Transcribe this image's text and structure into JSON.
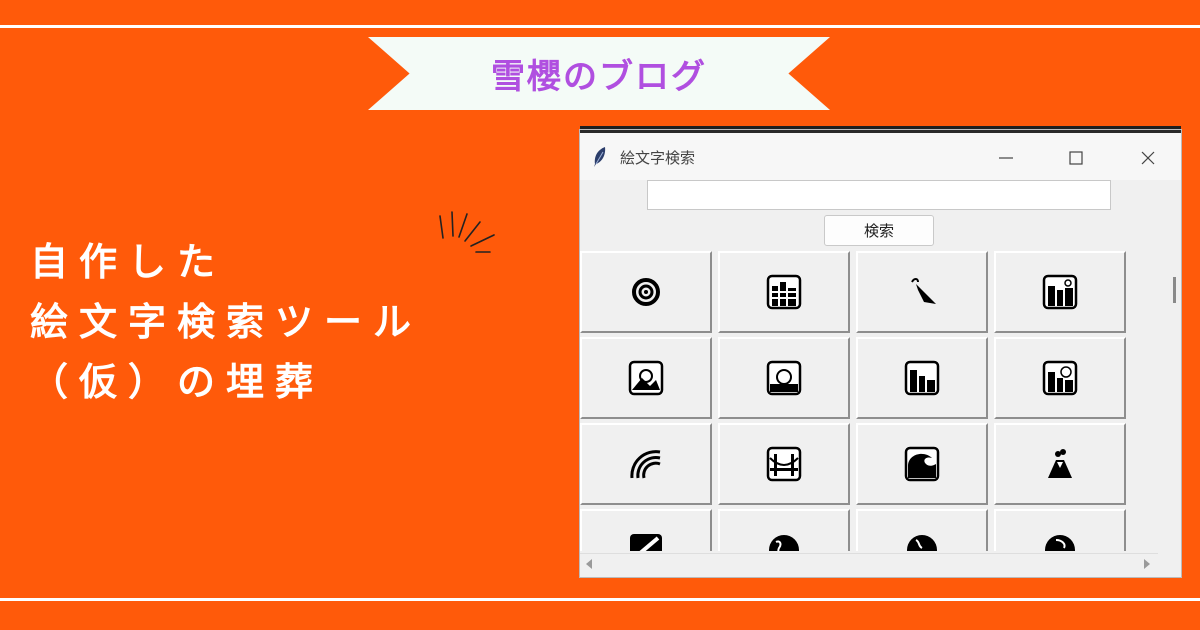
{
  "blog": {
    "name": "雪櫻のブログ"
  },
  "headline": {
    "line1": "自作した",
    "line2": "絵文字検索ツール",
    "line3": "（仮）の埋葬"
  },
  "window": {
    "title": "絵文字検索",
    "search_placeholder": "",
    "search_value": "",
    "search_button": "検索"
  },
  "emoji_grid": {
    "rows": [
      [
        "cyclone-icon",
        "foggy-city-icon",
        "closed-umbrella-icon",
        "night-city-icon"
      ],
      [
        "sunrise-over-mountains-icon",
        "sunrise-icon",
        "city-dusk-icon",
        "city-sunset-icon"
      ],
      [
        "rainbow-icon",
        "bridge-at-night-icon",
        "water-wave-icon",
        "volcano-icon"
      ],
      [
        "milky-way-icon",
        "globe-europe-africa-icon",
        "globe-americas-icon",
        "globe-asia-australia-icon"
      ]
    ]
  },
  "colors": {
    "background": "#FF5A0A",
    "ribbon": "#F4FBF7",
    "ribbon_text": "#B04FE0",
    "headline_text": "#FFFFFF"
  }
}
